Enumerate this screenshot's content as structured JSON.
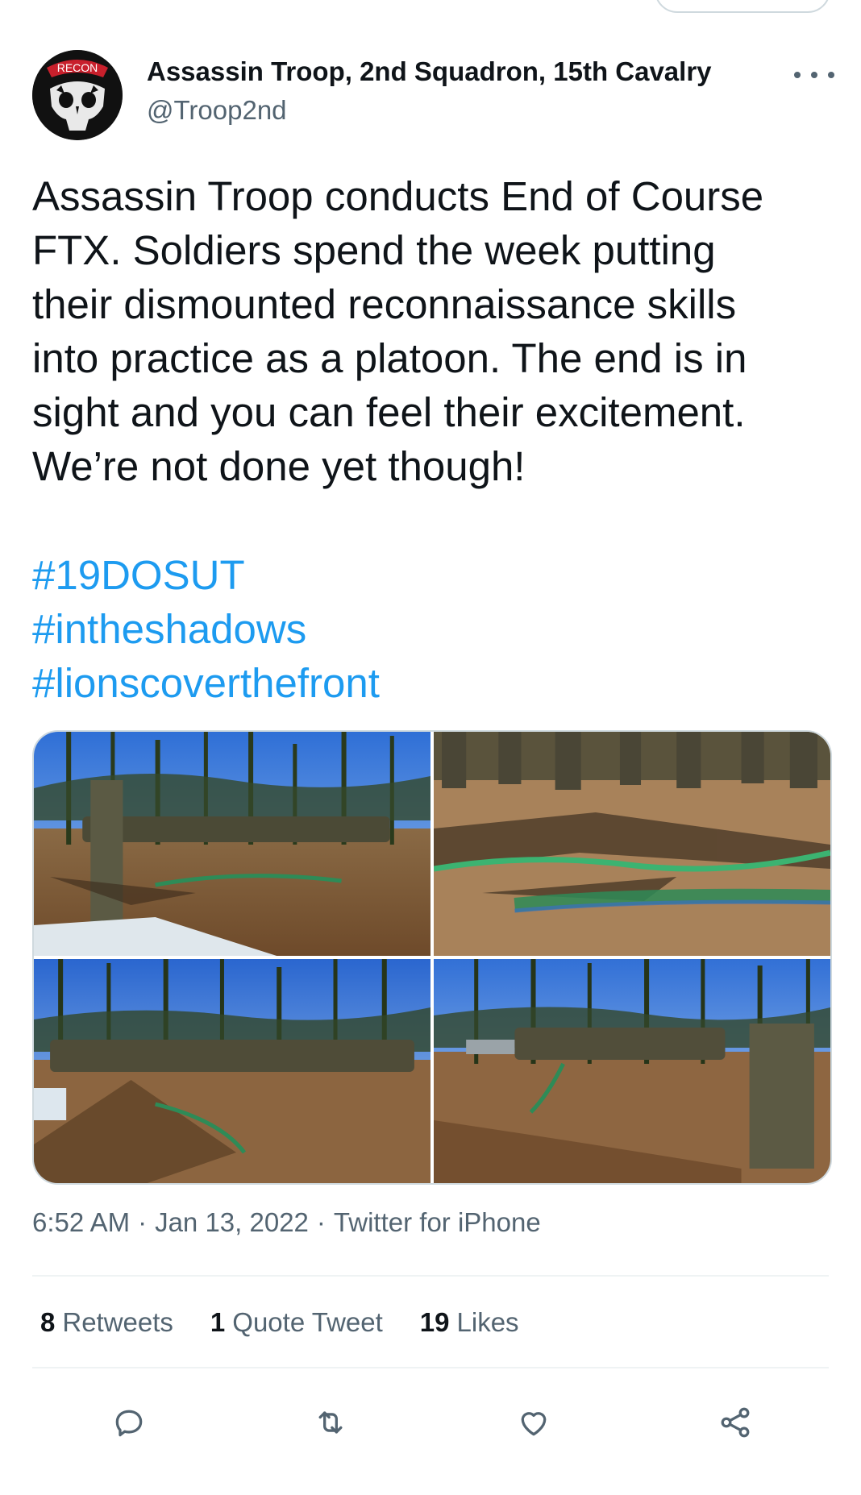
{
  "author": {
    "name": "Assassin Troop, 2nd Squadron, 15th Cavalry",
    "handle": "@Troop2nd",
    "avatar_text": "RECON"
  },
  "tweet": {
    "text_lines": [
      "Assassin Troop conducts End of Course",
      "FTX. Soldiers spend the week putting",
      "their dismounted reconnaissance skills",
      "into practice as a platoon. The end is in",
      "sight and you can feel their excitement.",
      "We’re not done yet though!"
    ],
    "hashtags": [
      "#19DOSUT",
      "#intheshadows",
      "#lionscoverthefront"
    ]
  },
  "media": [
    {
      "description": "photo-1"
    },
    {
      "description": "photo-2"
    },
    {
      "description": "photo-3"
    },
    {
      "description": "photo-4"
    }
  ],
  "meta": {
    "time": "6:52 AM",
    "date": "Jan 13, 2022",
    "source": "Twitter for iPhone",
    "separator": "·"
  },
  "stats": {
    "retweets_count": "8",
    "retweets_label": "Retweets",
    "quotes_count": "1",
    "quotes_label": "Quote Tweet",
    "likes_count": "19",
    "likes_label": "Likes"
  },
  "colors": {
    "link": "#1d9bf0",
    "secondary_text": "#536471",
    "divider": "#eff3f4"
  },
  "icons": {
    "reply": "reply-icon",
    "retweet": "retweet-icon",
    "like": "heart-icon",
    "share": "share-icon",
    "more": "more-icon"
  }
}
